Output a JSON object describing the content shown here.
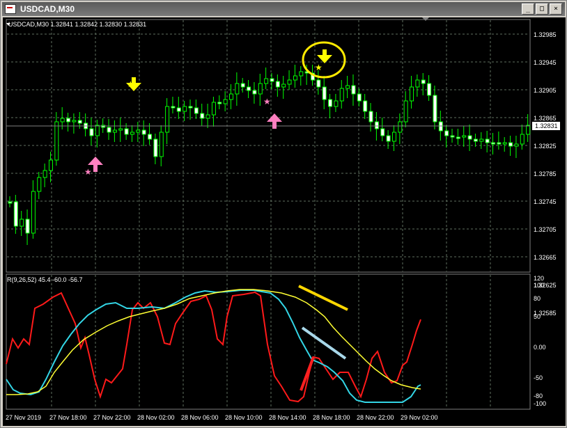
{
  "window": {
    "title": "USDCAD,M30",
    "buttons": [
      "_",
      "□",
      "×"
    ]
  },
  "chart": {
    "header": "USDCAD,M30  1.32841 1.32842 1.32830 1.32831",
    "current_price": "1.32831",
    "price_ticks": [
      "1.32985",
      "1.32945",
      "1.32905",
      "1.32865",
      "1.32825",
      "1.32785",
      "1.32745",
      "1.32705",
      "1.32665",
      "1.32625",
      "1.32585"
    ],
    "indicator_header": "R(9,26,52) 45.4 -60.0 -56.7",
    "indicator_ticks": [
      "100",
      "80",
      "50",
      "0.00",
      "-50",
      "-80",
      "-100"
    ],
    "indicator_tick_top": "120",
    "time_labels": [
      "27 Nov 2019",
      "27 Nov 18:00",
      "27 Nov 22:00",
      "28 Nov 02:00",
      "28 Nov 06:00",
      "28 Nov 10:00",
      "28 Nov 14:00",
      "28 Nov 18:00",
      "28 Nov 22:00",
      "29 Nov 02:00"
    ],
    "colors": {
      "candle": "#00ff00",
      "grid": "#5a6a5a",
      "fast_line": "#ff1a1a",
      "mid_line": "#33d6e6",
      "slow_line": "#ffff33",
      "arrow_down": "#ffff00",
      "arrow_up": "#ff80c0"
    }
  }
}
